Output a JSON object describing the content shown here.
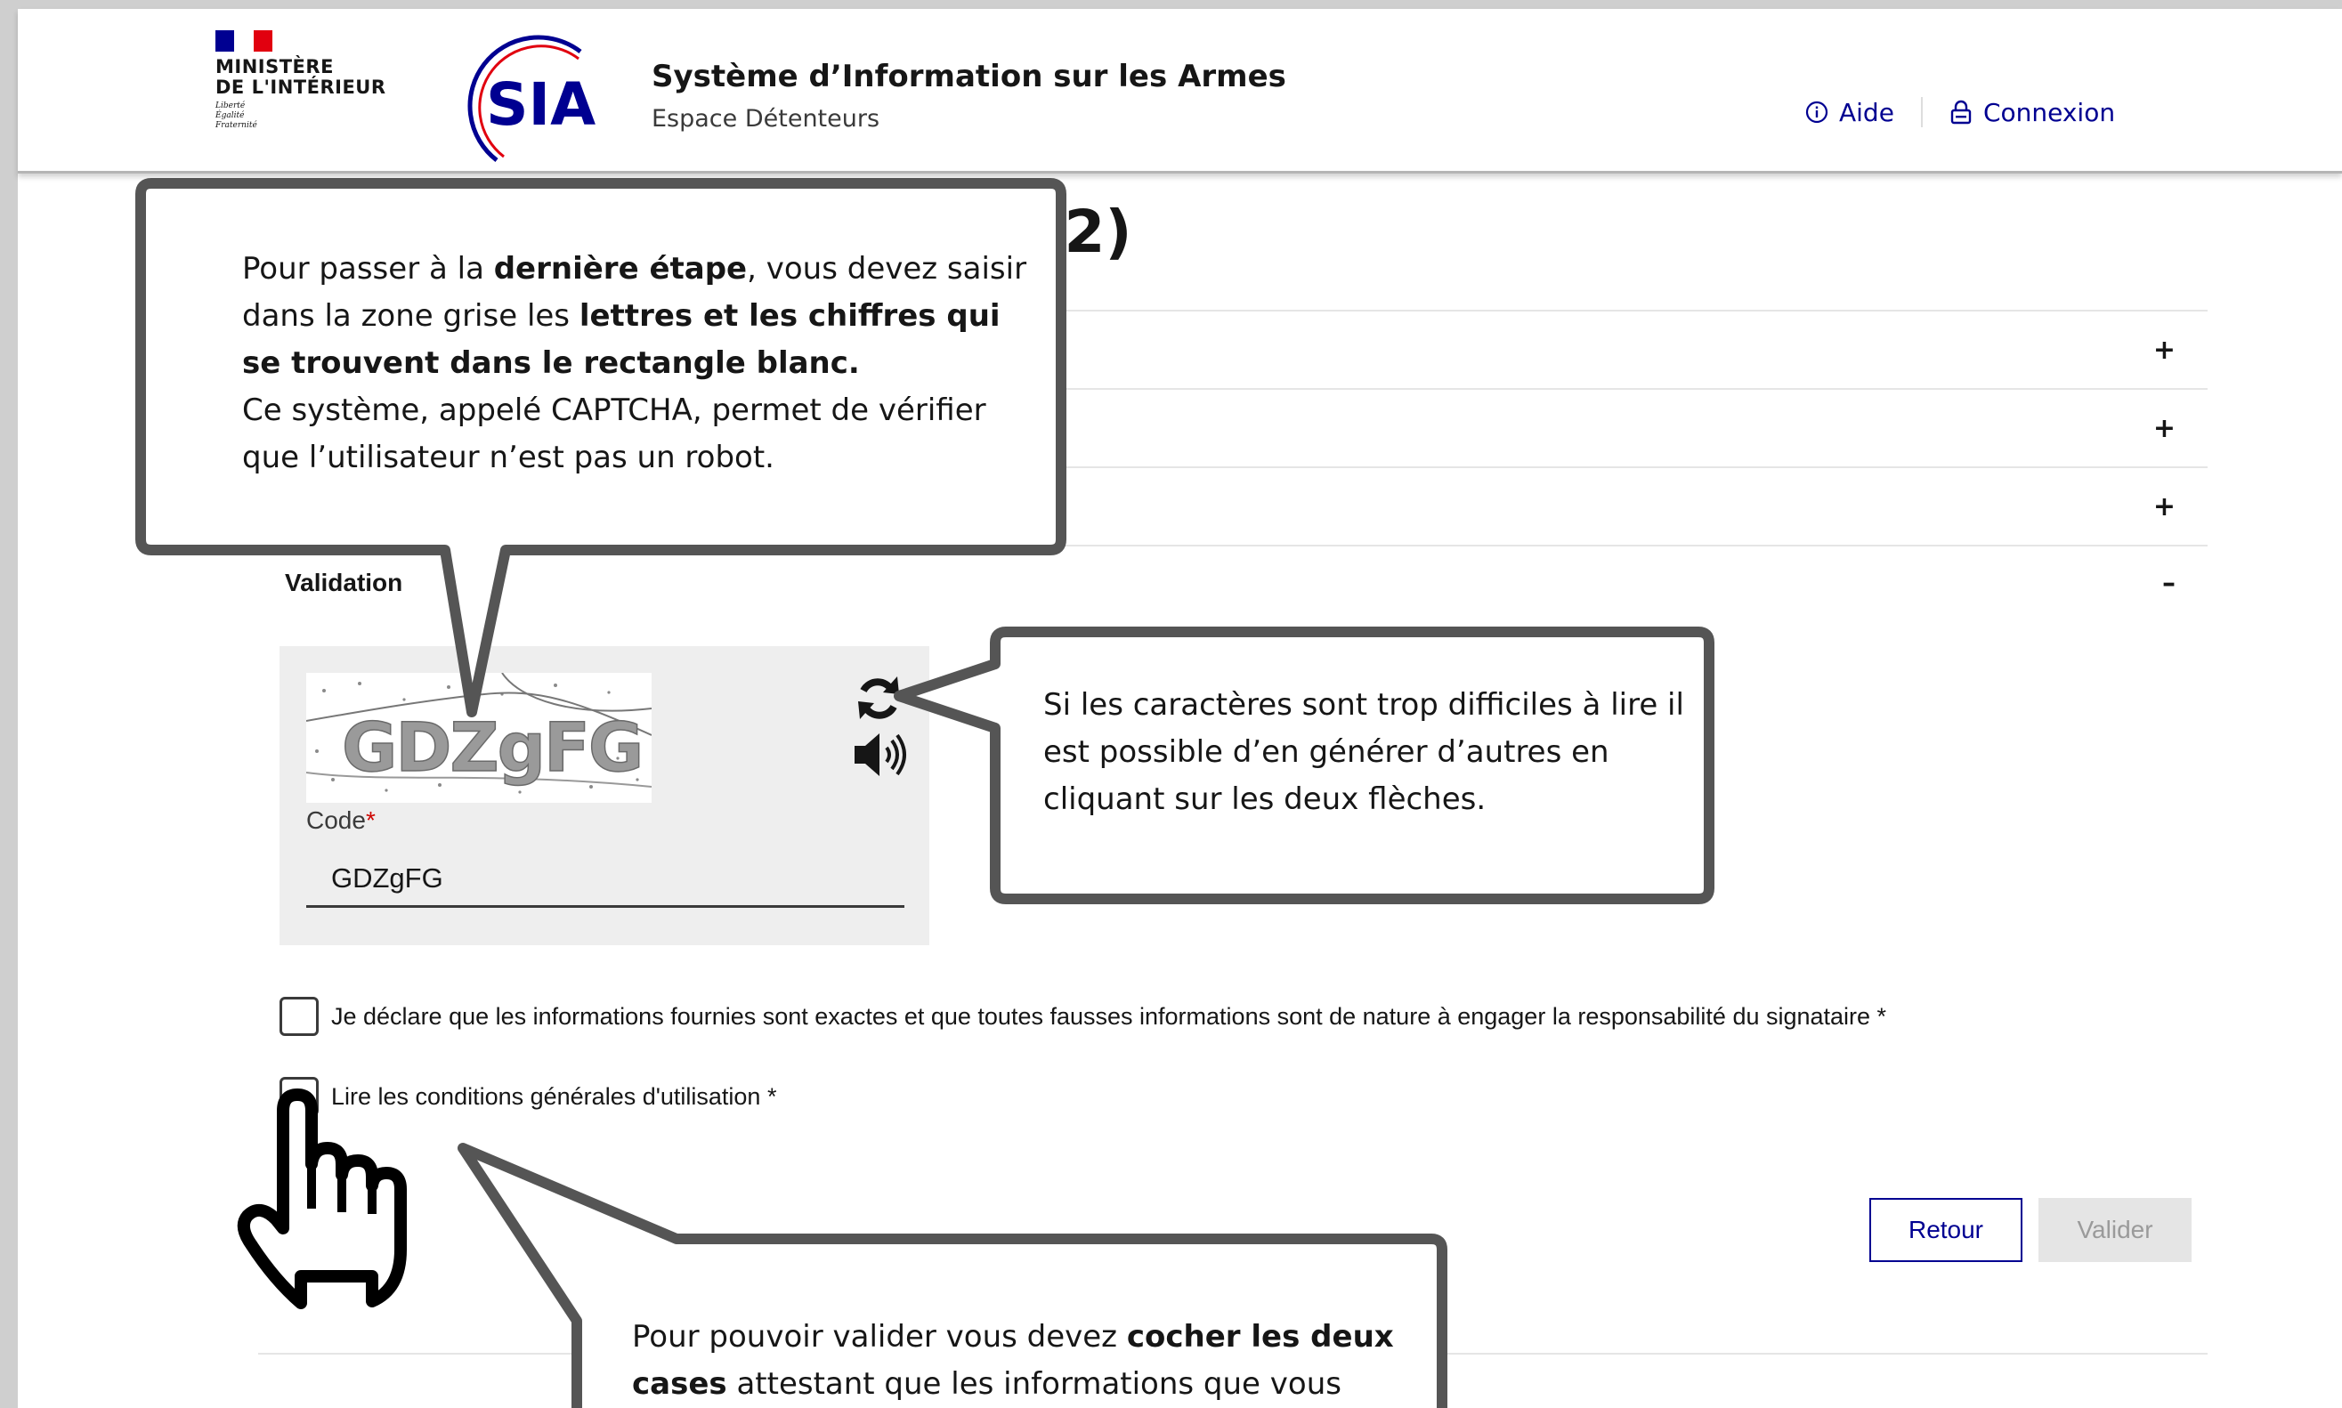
{
  "header": {
    "ministry_name": "MINISTÈRE\nDE L'INTÉRIEUR",
    "ministry_motto": "Liberté\nÉgalité\nFraternité",
    "logo_text": "SIA",
    "title": "Système d’Information sur les Armes",
    "subtitle": "Espace Détenteurs",
    "help_label": "Aide",
    "login_label": "Connexion"
  },
  "main": {
    "page_title_visible": "pte - Première partie (1/2)",
    "accordion": [
      {
        "label": "",
        "toggle": "+"
      },
      {
        "label": "",
        "toggle": "+"
      },
      {
        "label": "",
        "toggle": "+"
      },
      {
        "label": "Validation",
        "toggle": "–"
      }
    ],
    "captcha": {
      "image_text": "GDZgFG",
      "code_label": "Code",
      "required_mark": "*",
      "code_value": "GDZgFG"
    },
    "checkboxes": [
      {
        "label": "Je déclare que les informations fournies sont exactes et que toutes fausses informations sont de nature à engager la responsabilité du signataire *",
        "checked": false
      },
      {
        "label": "Lire les conditions générales d'utilisation *",
        "checked": false
      }
    ],
    "buttons": {
      "back": "Retour",
      "submit": "Valider"
    }
  },
  "callouts": {
    "captcha_tip": {
      "a": "Pour passer à la ",
      "b": "dernière étape",
      "c": ", vous devez saisir dans la zone grise les ",
      "d": "lettres et les chiffres qui se trouvent dans le rectangle blanc.",
      "e": "Ce système, appelé CAPTCHA, permet de vérifier que l’utilisateur n’est pas un robot."
    },
    "refresh_tip": "Si les caractères sont trop difficiles à lire il est possible d’en générer d’autres en cliquant sur les deux flèches.",
    "checkbox_tip": {
      "a": "Pour pouvoir valider vous devez ",
      "b": "cocher les deux cases",
      "c": " attestant que les informations que vous"
    }
  },
  "colors": {
    "accent": "#000091",
    "required": "#ce0500",
    "callout_border": "#555555",
    "captcha_bg": "#eeeeee"
  }
}
